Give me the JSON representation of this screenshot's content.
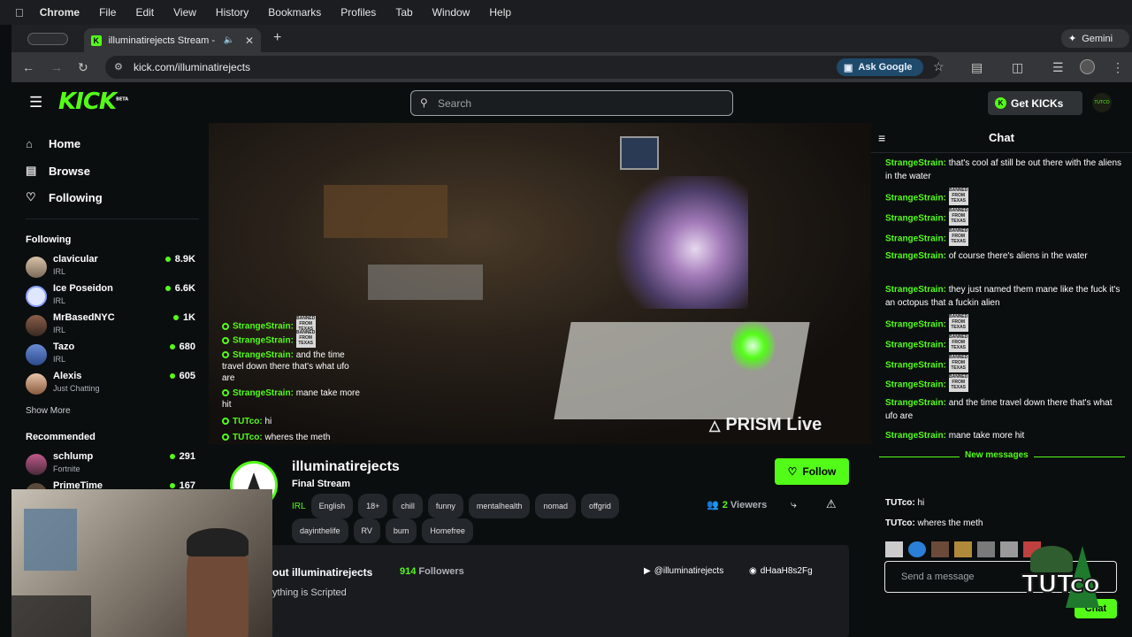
{
  "macmenu": {
    "app": "Chrome",
    "items": [
      "File",
      "Edit",
      "View",
      "History",
      "Bookmarks",
      "Profiles",
      "Tab",
      "Window",
      "Help"
    ]
  },
  "browser": {
    "tab_title": "illuminatirejects Stream -",
    "url": "kick.com/illuminatirejects",
    "ask_google": "Ask Google",
    "gemini": "Gemini"
  },
  "header": {
    "logo": "KICK",
    "logo_badge": "BETA",
    "search_placeholder": "Search",
    "get_kicks": "Get KICKs",
    "avatar_text": "TUTCO"
  },
  "nav": {
    "home": "Home",
    "browse": "Browse",
    "following": "Following"
  },
  "sidebar": {
    "following_title": "Following",
    "following": [
      {
        "name": "clavicular",
        "category": "IRL",
        "viewers": "8.9K"
      },
      {
        "name": "Ice Poseidon",
        "category": "IRL",
        "viewers": "6.6K"
      },
      {
        "name": "MrBasedNYC",
        "category": "IRL",
        "viewers": "1K"
      },
      {
        "name": "Tazo",
        "category": "IRL",
        "viewers": "680"
      },
      {
        "name": "Alexis",
        "category": "Just Chatting",
        "viewers": "605"
      }
    ],
    "show_more": "Show More",
    "recommended_title": "Recommended",
    "recommended": [
      {
        "name": "schlump",
        "category": "Fortnite",
        "viewers": "291"
      },
      {
        "name": "PrimeTime",
        "category": "",
        "viewers": "167"
      }
    ]
  },
  "video": {
    "watermark": "PRISM Live",
    "overlay_chat": [
      {
        "user": "StrangeStrain:",
        "text": "",
        "banned": true
      },
      {
        "user": "StrangeStrain:",
        "text": "",
        "banned": true
      },
      {
        "user": "StrangeStrain:",
        "text": "and the time travel down there that's what ufo are",
        "banned": false
      },
      {
        "user": "StrangeStrain:",
        "text": "mane take more hit",
        "banned": false
      },
      {
        "user": "TUTco:",
        "text": "hi",
        "banned": false
      },
      {
        "user": "TUTco:",
        "text": "wheres the meth",
        "banned": false
      }
    ]
  },
  "channel": {
    "name": "illuminatirejects",
    "title": "Final Stream",
    "category": "IRL",
    "tags": [
      "English",
      "18+",
      "chill",
      "funny",
      "mentalhealth",
      "nomad",
      "offgrid",
      "dayinthelife",
      "RV",
      "bum",
      "Homefree"
    ],
    "follow_label": "Follow",
    "viewers_count": "2",
    "viewers_label": "Viewers",
    "about_title": "out illuminatirejects",
    "followers_count": "914",
    "followers_label": "Followers",
    "youtube": "@illuminatirejects",
    "discord": "dHaaH8s2Fg",
    "bio": "ything is Scripted"
  },
  "chat": {
    "title": "Chat",
    "messages": [
      {
        "user": "StrangeStrain:",
        "text": "that's cool af still be out there with the aliens in the water",
        "banned": false
      },
      {
        "user": "StrangeStrain:",
        "text": "",
        "banned": true
      },
      {
        "user": "StrangeStrain:",
        "text": "",
        "banned": true
      },
      {
        "user": "StrangeStrain:",
        "text": "",
        "banned": true
      },
      {
        "user": "StrangeStrain:",
        "text": "of course there's aliens in the water",
        "banned": false
      },
      {
        "user": "StrangeStrain:",
        "text": "they just named them mane like the fuck it's an octopus that a fuckin alien",
        "banned": false
      },
      {
        "user": "StrangeStrain:",
        "text": "",
        "banned": true
      },
      {
        "user": "StrangeStrain:",
        "text": "",
        "banned": true
      },
      {
        "user": "StrangeStrain:",
        "text": "",
        "banned": true
      },
      {
        "user": "StrangeStrain:",
        "text": "",
        "banned": true
      },
      {
        "user": "StrangeStrain:",
        "text": "and the time travel down there that's what ufo are",
        "banned": false
      },
      {
        "user": "StrangeStrain:",
        "text": "mane take more hit",
        "banned": false
      }
    ],
    "new_messages": "New messages",
    "new": [
      {
        "user": "TUTco:",
        "text": "hi"
      },
      {
        "user": "TUTco:",
        "text": "wheres the meth"
      }
    ],
    "banned_emote": "BANNED FROM TEXAS",
    "input_placeholder": "Send a message",
    "send_label": "Chat",
    "sticker": "TUTco"
  },
  "colors": {
    "accent": "#53fc18",
    "bg": "#0b0e0f"
  }
}
